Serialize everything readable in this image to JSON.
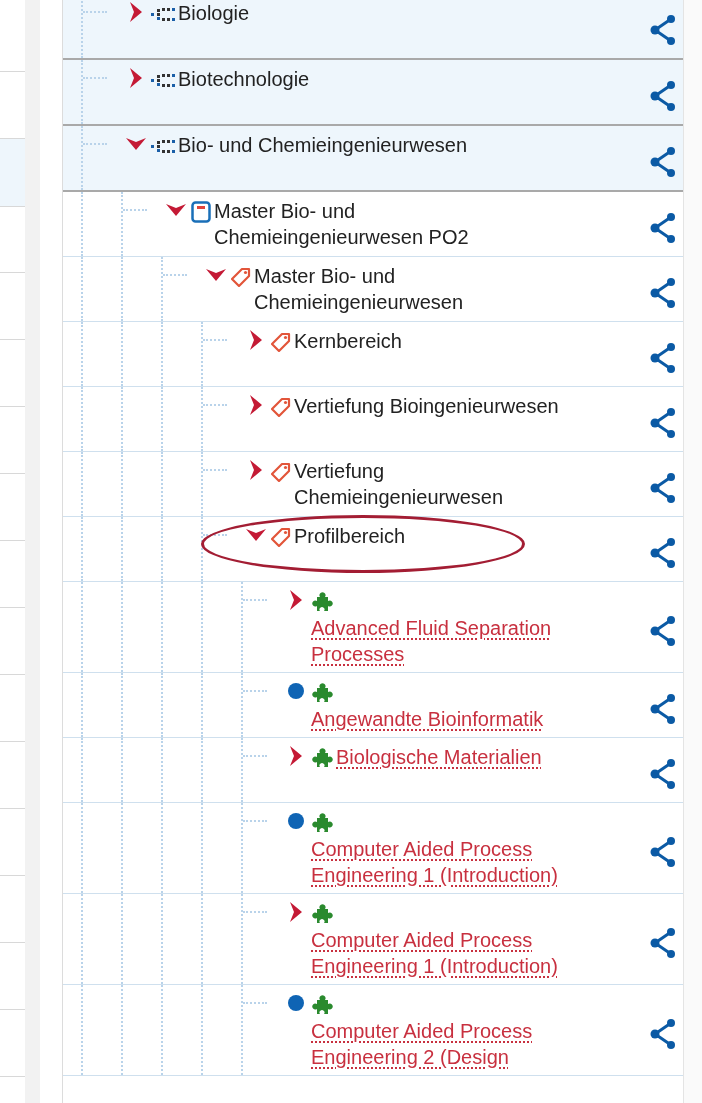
{
  "tree": [
    {
      "label": "Biologie",
      "kind": "category",
      "has_children": true,
      "expanded": false,
      "link": false,
      "highlighted": false
    },
    {
      "label": "Biotechnologie",
      "kind": "category",
      "has_children": true,
      "expanded": false,
      "link": false,
      "highlighted": false
    },
    {
      "label": "Bio- und Chemieingenieurwesen",
      "kind": "category",
      "has_children": true,
      "expanded": true,
      "link": false,
      "highlighted": false,
      "children": [
        {
          "label": "Master Bio- und Chemieingenieurwesen PO2",
          "kind": "program",
          "has_children": true,
          "expanded": true,
          "link": false,
          "highlighted": false,
          "children": [
            {
              "label": "Master Bio- und Chemieingenieurwesen",
              "kind": "tag",
              "has_children": true,
              "expanded": true,
              "link": false,
              "highlighted": false,
              "children": [
                {
                  "label": "Kernbereich",
                  "kind": "tag",
                  "has_children": true,
                  "expanded": false,
                  "link": false,
                  "highlighted": false
                },
                {
                  "label": "Vertiefung Bioingenieurwesen",
                  "kind": "tag",
                  "has_children": true,
                  "expanded": false,
                  "link": false,
                  "highlighted": false
                },
                {
                  "label": "Vertiefung Chemieingenieurwesen",
                  "kind": "tag",
                  "has_children": true,
                  "expanded": false,
                  "link": false,
                  "highlighted": false
                },
                {
                  "label": "Profilbereich",
                  "kind": "tag",
                  "has_children": true,
                  "expanded": true,
                  "link": false,
                  "highlighted": true,
                  "children": [
                    {
                      "label": "Advanced Fluid Separation Processes",
                      "kind": "module",
                      "has_children": true,
                      "expanded": false,
                      "link": true,
                      "highlighted": false
                    },
                    {
                      "label": "Angewandte Bioinformatik",
                      "kind": "module",
                      "has_children": false,
                      "link": true,
                      "highlighted": false
                    },
                    {
                      "label": "Biologische Materialien",
                      "kind": "module",
                      "has_children": true,
                      "expanded": false,
                      "link": true,
                      "highlighted": false
                    },
                    {
                      "label": "Computer Aided Process Engineering 1 (Introduction)",
                      "kind": "module",
                      "has_children": false,
                      "link": true,
                      "highlighted": false
                    },
                    {
                      "label": "Computer Aided Process Engineering 1 (Introduction)",
                      "kind": "module",
                      "has_children": true,
                      "expanded": false,
                      "link": true,
                      "highlighted": false
                    },
                    {
                      "label": "Computer Aided Process Engineering 2 (Design",
                      "kind": "module",
                      "has_children": false,
                      "link": true,
                      "highlighted": false
                    }
                  ]
                }
              ]
            }
          ]
        }
      ]
    }
  ]
}
